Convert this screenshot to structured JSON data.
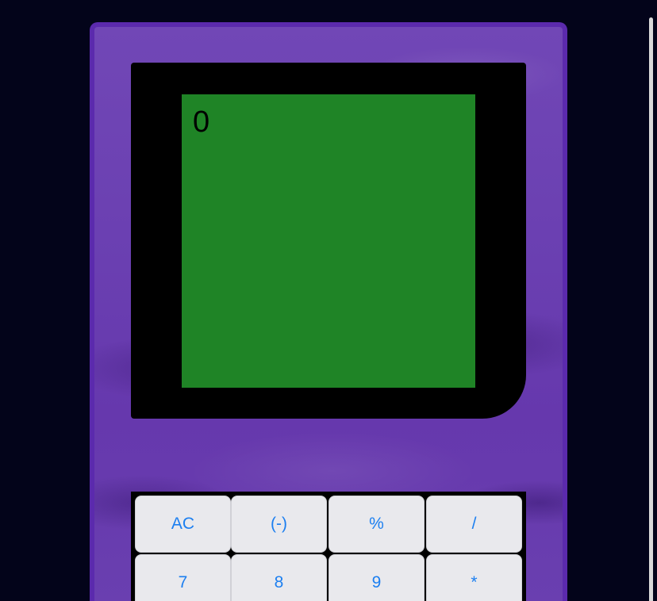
{
  "display": {
    "value": "0"
  },
  "keypad": {
    "rows": [
      [
        "AC",
        "(-)",
        "%",
        "/"
      ],
      [
        "7",
        "8",
        "9",
        "*"
      ]
    ]
  },
  "colors": {
    "page_background": "#03041a",
    "case": "#6a3fb1",
    "case_border": "#5b2aad",
    "bezel": "#000000",
    "screen": "#1f8426",
    "key_background": "#e9e9ed",
    "key_text": "#1c7ff0"
  }
}
